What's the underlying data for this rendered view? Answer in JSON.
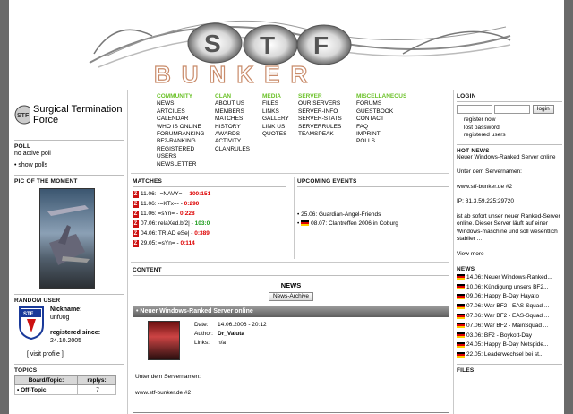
{
  "site": {
    "logo_text_top": "ST",
    "logo_text_bottom": "BUNKER",
    "brand_name": "Surgical Termination Force"
  },
  "colors": {
    "accent_green": "#6cc22a",
    "score_red": "#d00000",
    "score_green": "#1a9a1a",
    "news_bar": "#6e6e6e"
  },
  "menu": [
    {
      "title": "COMMUNITY",
      "items": [
        "NEWS",
        "ARTCILES",
        "CALENDAR",
        "WHO IS ONLINE",
        "FORUMRANKING",
        "BF2-RANKING",
        "REGISTERED",
        "USERS",
        "NEWSLETTER"
      ]
    },
    {
      "title": "CLAN",
      "items": [
        "ABOUT US",
        "MEMBERS",
        "MATCHES",
        "HISTORY",
        "AWARDS",
        "ACTIVITY",
        "CLANRULES"
      ]
    },
    {
      "title": "MEDIA",
      "items": [
        "FILES",
        "LINKS",
        "GALLERY",
        "LINK US",
        "QUOTES"
      ]
    },
    {
      "title": "SERVER",
      "items": [
        "OUR SERVERS",
        "SERVER-INFO",
        "SERVER-STATS",
        "SERVERRULES",
        "TEAMSPEAK"
      ]
    },
    {
      "title": "MISCELLANEOUS",
      "items": [
        "FORUMS",
        "GUESTBOOK",
        "CONTACT",
        "FAQ",
        "IMPRINT",
        "POLLS"
      ]
    }
  ],
  "left": {
    "poll_heading": "POLL",
    "poll_text": "no active poll",
    "show_polls": "• show polls",
    "pic_heading": "PIC OF THE MOMENT",
    "random_user_heading": "RANDOM USER",
    "nickname_label": "Nickname:",
    "nickname": "unf00g",
    "registered_label": "registered since:",
    "registered_date": "24.10.2005",
    "visit_profile": "[ visit profile ]",
    "topics_heading": "TOPICS",
    "topics_col1": "Board/Topic:",
    "topics_col2": "replys:",
    "topics_row1": "• Off-Topic",
    "topics_row1_replies": "7"
  },
  "matches": {
    "heading": "MATCHES",
    "rows": [
      {
        "date": "11.06:",
        "opponent": "-=NAVY=- -",
        "score": "100:151",
        "win": false
      },
      {
        "date": "11.06:",
        "opponent": "-=KTx=- -",
        "score": "0:290",
        "win": false
      },
      {
        "date": "11.06:",
        "opponent": "=sYn= -",
        "score": "0:228",
        "win": false
      },
      {
        "date": "07.06:",
        "opponent": "relaXed.bf2| -",
        "score": "103:0",
        "win": true
      },
      {
        "date": "04.06:",
        "opponent": "TRIAD eSe| -",
        "score": "0:389",
        "win": false
      },
      {
        "date": "29.05:",
        "opponent": "=sYn= -",
        "score": "0:114",
        "win": false
      }
    ]
  },
  "events": {
    "heading": "UPCOMING EVENTS",
    "rows": [
      "25.06: Guardian-Angel-Friends",
      "08.07: Clantreffen 2006 in Coburg"
    ]
  },
  "content": {
    "heading": "CONTENT",
    "news_title": "NEWS",
    "news_archive_button": "News-Archive",
    "article_title": "• Neuer Windows-Ranked Server online",
    "date_label": "Date:",
    "date_value": "14.06.2006 - 20:12",
    "author_label": "Author:",
    "author_value": "Dr_Valuta",
    "links_label": "Links:",
    "links_value": "n/a",
    "body_line1": "Unter dem Servernamen:",
    "body_line2": "www.stf-bunker.de #2"
  },
  "right": {
    "login_heading": "LOGIN",
    "login_button": "login",
    "register_now": "register now",
    "lost_password": "lost password",
    "registered_users": "registered users",
    "hotnews_heading": "HOT NEWS",
    "hotnews_title": "Neuer Windows-Ranked Server online",
    "hotnews_p1": "Unter dem Servernamen:",
    "hotnews_p2": "www.stf-bunker.de #2",
    "hotnews_p3": "IP: 81.3.59.225:29720",
    "hotnews_p4": "ist ab sofort unser neuer Ranked-Server online. Dieser Server läuft auf einer Windows-maschine und soll wesentlich stabiler ...",
    "view_more": "View more",
    "news_heading": "NEWS",
    "news_items": [
      "14.06: Neuer Windows-Ranked...",
      "10.06: Kündigung unsers BF2...",
      "09.06: Happy B-Day Hayato",
      "07.06: War BF2 - EAS-Squad ...",
      "07.06: War BF2 - EAS-Squad ...",
      "07.06: War BF2 - MainSquad ...",
      "03.06: BF2 - Boykott-Day",
      "24.05: Happy B-Day Netspide...",
      "22.05: Leaderwechsel bei st..."
    ],
    "files_heading": "FILES"
  }
}
